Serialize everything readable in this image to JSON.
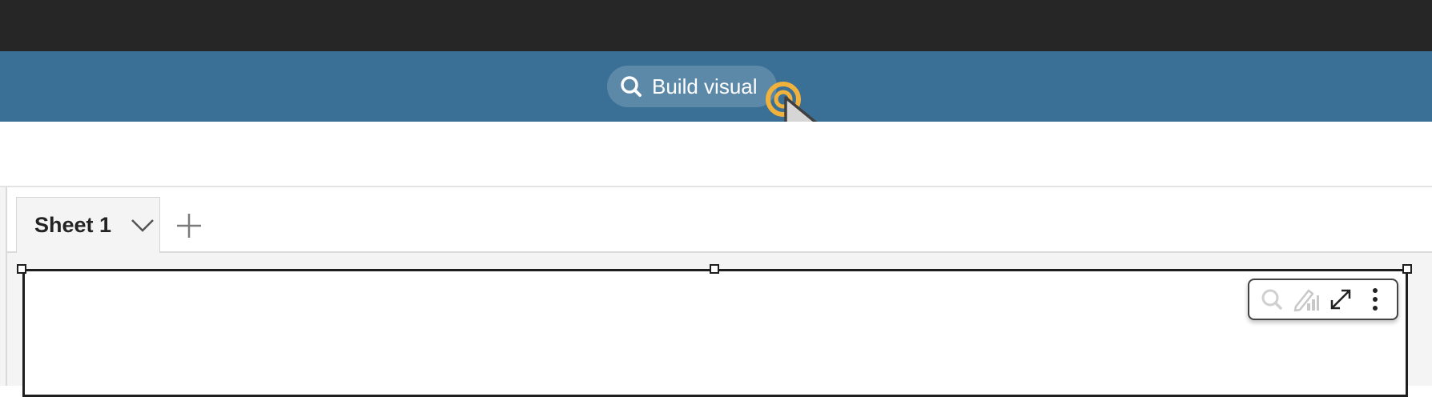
{
  "header": {
    "build_visual_label": "Build visual",
    "build_visual_icon": "search-icon"
  },
  "sheets": {
    "tabs": [
      {
        "label": "Sheet 1",
        "icon": "chevron-down-icon"
      }
    ],
    "add_icon": "plus-icon"
  },
  "visual_toolbar": {
    "icons": [
      "search-icon",
      "edit-chart-icon",
      "expand-icon",
      "more-vertical-icon"
    ]
  },
  "colors": {
    "topbar": "#262626",
    "header_bar": "#3a7096",
    "canvas_background": "#f4f4f4",
    "cursor_click_ring": "#f0b23c"
  }
}
